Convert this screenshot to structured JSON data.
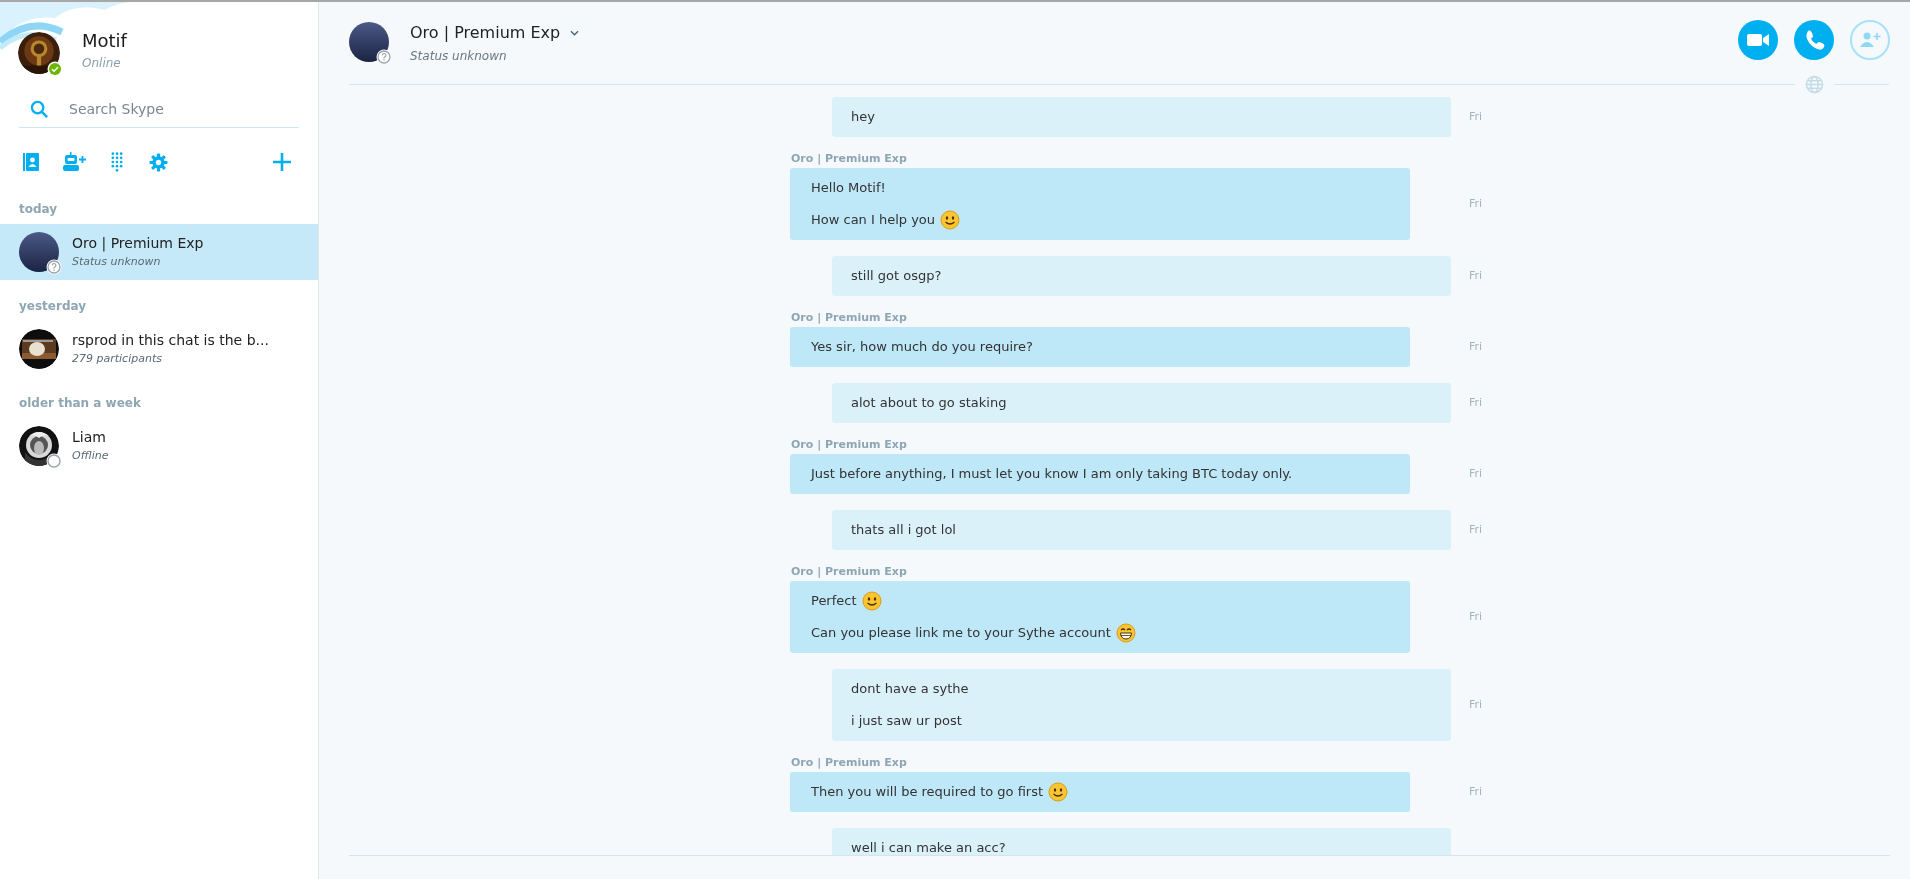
{
  "profile": {
    "name": "Motif",
    "status": "Online",
    "badge": {
      "kind": "online"
    }
  },
  "search": {
    "placeholder": "Search Skype"
  },
  "conversation_groups": [
    {
      "label": "today",
      "items": [
        {
          "name": "Oro | Premium Exp",
          "subtitle": "Status unknown",
          "badge": {
            "kind": "unknown"
          },
          "avatar": {
            "kind": "plain"
          },
          "selected": true
        }
      ]
    },
    {
      "label": "yesterday",
      "items": [
        {
          "name": "rsprod in this chat is the b...",
          "subtitle": "279 participants",
          "selected": false
        }
      ]
    },
    {
      "label": "older than a week",
      "items": [
        {
          "name": "Liam",
          "subtitle": "Offline",
          "badge": {
            "kind": "offline"
          },
          "selected": false
        }
      ]
    }
  ],
  "chat": {
    "title": "Oro | Premium Exp",
    "status": "Status unknown",
    "badge": {
      "kind": "unknown"
    },
    "messages": [
      {
        "kind": "outgoing",
        "lines": [
          {
            "text": "hey"
          }
        ],
        "time": "Fri"
      },
      {
        "kind": "incoming",
        "sender": "Oro | Premium Exp",
        "lines": [
          {
            "text": "Hello Motif!"
          },
          {
            "text": "How can I help you",
            "emoji": {
              "kind": "smile"
            }
          }
        ],
        "time": "Fri"
      },
      {
        "kind": "outgoing",
        "lines": [
          {
            "text": "still got osgp?"
          }
        ],
        "time": "Fri"
      },
      {
        "kind": "incoming",
        "sender": "Oro | Premium Exp",
        "lines": [
          {
            "text": "Yes sir, how much do you require?"
          }
        ],
        "time": "Fri"
      },
      {
        "kind": "outgoing",
        "lines": [
          {
            "text": "alot about to go staking"
          }
        ],
        "time": "Fri"
      },
      {
        "kind": "incoming",
        "sender": "Oro | Premium Exp",
        "lines": [
          {
            "text": "Just before anything, I must let you know I am only taking BTC today only."
          }
        ],
        "time": "Fri"
      },
      {
        "kind": "outgoing",
        "lines": [
          {
            "text": "thats all i got lol"
          }
        ],
        "time": "Fri"
      },
      {
        "kind": "incoming",
        "sender": "Oro | Premium Exp",
        "lines": [
          {
            "text": "Perfect",
            "emoji": {
              "kind": "smile"
            }
          },
          {
            "text": "Can you please link me to your Sythe account",
            "emoji": {
              "kind": "grin"
            }
          }
        ],
        "time": "Fri"
      },
      {
        "kind": "outgoing",
        "lines": [
          {
            "text": "dont have a sythe"
          },
          {
            "text": "i just saw ur post"
          }
        ],
        "time": "Fri"
      },
      {
        "kind": "incoming",
        "sender": "Oro | Premium Exp",
        "lines": [
          {
            "text": "Then you will be required to go first",
            "emoji": {
              "kind": "smile"
            }
          }
        ],
        "time": "Fri"
      },
      {
        "kind": "outgoing",
        "lines": [
          {
            "text": "well i can make an acc?"
          }
        ]
      }
    ]
  }
}
